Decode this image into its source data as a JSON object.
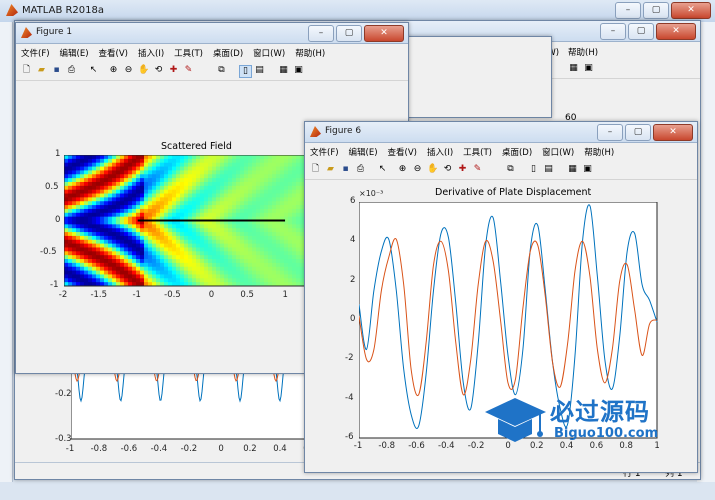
{
  "app": {
    "title": "MATLAB R2018a"
  },
  "bg": {
    "menu": [
      "文件(F)",
      "编辑(E)",
      "查看(V)",
      "插入(I)",
      "工具(T)",
      "桌面(D)",
      "窗口(W)",
      "帮助(H)"
    ],
    "partial_menu_w": "窗口(W)",
    "partial_menu_h": "帮助(H)",
    "number_60": "60",
    "status_row": "行 1",
    "status_col": "列 1"
  },
  "bg_plot": {
    "y_ticks": [
      "-0.2",
      "-0.3"
    ],
    "x_ticks": [
      "-1",
      "-0.8",
      "-0.6",
      "-0.4",
      "-0.2",
      "0",
      "0.2",
      "0.4",
      "0.6"
    ]
  },
  "fig1": {
    "title": "Figure 1",
    "menu": [
      "文件(F)",
      "编辑(E)",
      "查看(V)",
      "插入(I)",
      "工具(T)",
      "桌面(D)",
      "窗口(W)",
      "帮助(H)"
    ],
    "chart_title": "Scattered Field",
    "y_ticks": [
      "1",
      "0.5",
      "0",
      "-0.5",
      "-1"
    ],
    "x_ticks": [
      "-2",
      "-1.5",
      "-1",
      "-0.5",
      "0",
      "0.5",
      "1",
      "1.5"
    ]
  },
  "fig6": {
    "title": "Figure 6",
    "menu": [
      "文件(F)",
      "编辑(E)",
      "查看(V)",
      "插入(I)",
      "工具(T)",
      "桌面(D)",
      "窗口(W)",
      "帮助(H)"
    ],
    "chart_title": "Derivative of Plate Displacement",
    "exponent": "×10⁻³",
    "y_ticks": [
      "6",
      "4",
      "2",
      "0",
      "-2",
      "-4",
      "-6"
    ],
    "x_ticks": [
      "-1",
      "-0.8",
      "-0.6",
      "-0.4",
      "-0.2",
      "0",
      "0.2",
      "0.4",
      "0.6",
      "0.8",
      "1"
    ]
  },
  "watermark": {
    "brand": "必过源码",
    "url": "Biguo100.com"
  },
  "chart_data": [
    {
      "type": "heatmap",
      "title": "Scattered Field",
      "xlim": [
        -2,
        1.8
      ],
      "ylim": [
        -1,
        1
      ],
      "x_ticks": [
        -2,
        -1.5,
        -1,
        -0.5,
        0,
        0.5,
        1,
        1.5
      ],
      "y_ticks": [
        -1,
        -0.5,
        0,
        0.5,
        1
      ],
      "plate": {
        "x": [
          -1,
          1
        ],
        "y": 0
      }
    },
    {
      "type": "line",
      "title": "Derivative of Plate Displacement",
      "xlim": [
        -1,
        1
      ],
      "ylim": [
        -6,
        6
      ],
      "y_multiplier": "1e-3",
      "x_ticks": [
        -1,
        -0.8,
        -0.6,
        -0.4,
        -0.2,
        0,
        0.2,
        0.4,
        0.6,
        0.8,
        1
      ],
      "y_ticks": [
        -6,
        -4,
        -2,
        0,
        2,
        4,
        6
      ],
      "series": [
        {
          "color": "#0072BD",
          "x": [
            -1,
            -0.95,
            -0.9,
            -0.85,
            -0.8,
            -0.75,
            -0.7,
            -0.65,
            -0.6,
            -0.55,
            -0.5,
            -0.45,
            -0.4,
            -0.35,
            -0.3,
            -0.25,
            -0.2,
            -0.15,
            -0.1,
            -0.05,
            0,
            0.05,
            0.1,
            0.15,
            0.2,
            0.25,
            0.3,
            0.35,
            0.4,
            0.45,
            0.5,
            0.55,
            0.6,
            0.65,
            0.7,
            0.75,
            0.8,
            0.85,
            0.9,
            0.95,
            1
          ],
          "y": [
            0.8,
            -1.5,
            1.5,
            3.5,
            4.1,
            1.5,
            -2.5,
            -4.8,
            -5.4,
            -2.8,
            1.5,
            4.4,
            4.2,
            0.8,
            -3.2,
            -4.5,
            -1.2,
            3.8,
            5.2,
            2.0,
            -1.8,
            -3.8,
            -1.5,
            3.6,
            4.8,
            1.5,
            -2.2,
            -4.5,
            -5.3,
            -1.8,
            4.0,
            5.8,
            2.2,
            -2.0,
            -3.5,
            -0.8,
            3.5,
            4.4,
            1.8,
            1.0,
            -0.1
          ]
        },
        {
          "color": "#D95319",
          "x": [
            -1,
            -0.95,
            -0.9,
            -0.85,
            -0.8,
            -0.75,
            -0.7,
            -0.65,
            -0.6,
            -0.55,
            -0.5,
            -0.45,
            -0.4,
            -0.35,
            -0.3,
            -0.25,
            -0.2,
            -0.15,
            -0.1,
            -0.05,
            0,
            0.05,
            0.1,
            0.15,
            0.2,
            0.25,
            0.3,
            0.35,
            0.4,
            0.45,
            0.5,
            0.55,
            0.6,
            0.65,
            0.7,
            0.75,
            0.8,
            0.85,
            0.9,
            0.95,
            1
          ],
          "y": [
            0.2,
            -2.0,
            -1.5,
            1.5,
            3.2,
            4.1,
            1.8,
            -2.5,
            -3.8,
            -1.2,
            2.8,
            4.0,
            2.5,
            -1.2,
            -3.8,
            -2.0,
            1.8,
            4.0,
            3.0,
            0.0,
            -3.2,
            -3.0,
            0.6,
            3.5,
            3.8,
            1.2,
            -2.2,
            -3.4,
            -1.2,
            2.5,
            4.0,
            2.2,
            -1.5,
            -3.2,
            -1.5,
            2.0,
            2.8,
            0.5,
            -1.8,
            -0.2,
            0.0
          ]
        }
      ]
    }
  ]
}
